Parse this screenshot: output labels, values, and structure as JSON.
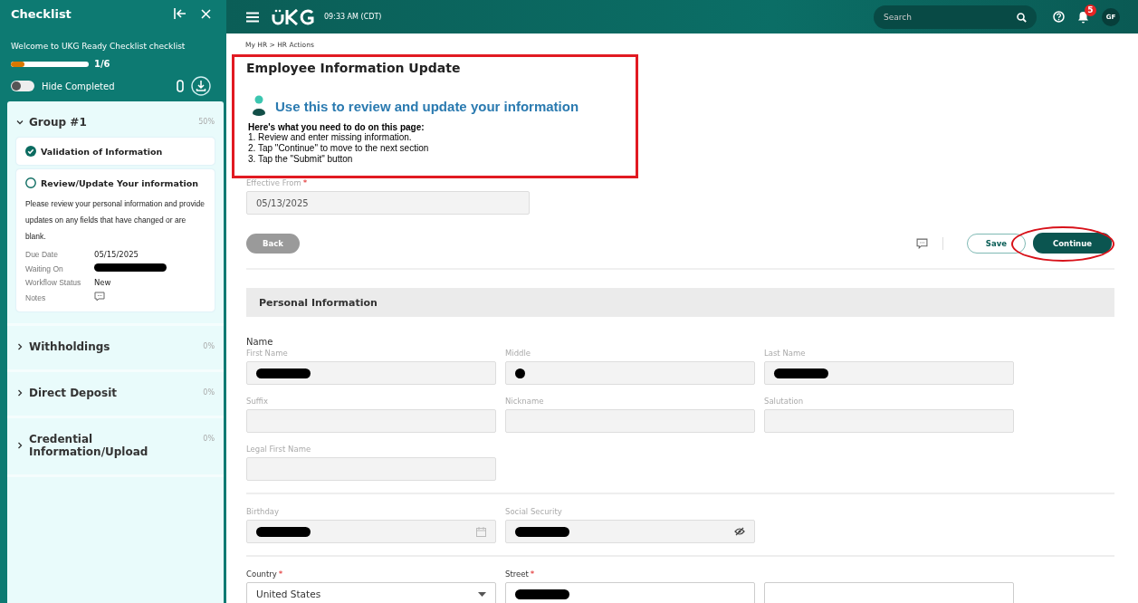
{
  "sidebar": {
    "title": "Checklist",
    "welcome": "Welcome to UKG Ready Checklist checklist",
    "progress": {
      "level": 0.17,
      "reading": "1/6"
    },
    "hide_completed": {
      "label": "Hide Completed",
      "on": false
    },
    "groups": [
      {
        "title": "Group #1",
        "percent": "50%",
        "expanded": true,
        "tasks": [
          {
            "title": "Validation of Information",
            "done": true
          },
          {
            "title": "Review/Update Your information",
            "done": false,
            "description": "Please review your personal information and provide updates on any fields that have changed or are blank.",
            "details": [
              {
                "label": "Due Date",
                "kind": "text",
                "value": "05/15/2025"
              },
              {
                "label": "Waiting On",
                "kind": "redacted"
              },
              {
                "label": "Workflow Status",
                "kind": "text",
                "value": "New"
              },
              {
                "label": "Notes",
                "kind": "notes"
              }
            ]
          }
        ]
      },
      {
        "title": "Withholdings",
        "percent": "0%",
        "expanded": false
      },
      {
        "title": "Direct Deposit",
        "percent": "0%",
        "expanded": false
      },
      {
        "title": "Credential Information/Upload",
        "percent": "0%",
        "expanded": false
      }
    ]
  },
  "topbar": {
    "time": "09:33 AM (CDT)",
    "search": {
      "placeholder": "Search"
    },
    "notifications": "5",
    "avatar": "GF"
  },
  "breadcrumb": "My HR > HR Actions",
  "page_title": "Employee Information Update",
  "banner": {
    "heading": "Use this to review and update your information",
    "instructions_title": "Here's what you need to do on this page:",
    "steps": [
      "1. Review and enter missing information.",
      "2. Tap \"Continue\" to move to the next section",
      "3. Tap the \"Submit\" button"
    ]
  },
  "effective_from": {
    "label": "Effective From",
    "required_mark": "*",
    "value": "05/13/2025"
  },
  "actions": [
    {
      "label": "Back",
      "kind": "back",
      "disabled": true
    },
    {
      "label": "Save",
      "kind": "save",
      "disabled": false
    },
    {
      "label": "Continue",
      "kind": "continue",
      "disabled": false
    }
  ],
  "section": "Personal Information",
  "name_label": "Name",
  "field_blocks": [
    {
      "rows": [
        [
          {
            "label": "First Name",
            "kind": "text",
            "redacted": true,
            "editable": false
          },
          {
            "label": "Middle",
            "kind": "initial",
            "redacted": true,
            "editable": false
          },
          {
            "label": "Last Name",
            "kind": "text",
            "redacted": true,
            "editable": false
          }
        ],
        [
          {
            "label": "Suffix",
            "kind": "text",
            "redacted": false,
            "editable": false
          },
          {
            "label": "Nickname",
            "kind": "text",
            "redacted": false,
            "editable": false
          },
          {
            "label": "Salutation",
            "kind": "text",
            "redacted": false,
            "editable": false
          }
        ],
        [
          {
            "label": "Legal First Name",
            "kind": "text",
            "redacted": false,
            "editable": false
          }
        ]
      ]
    },
    {
      "rows": [
        [
          {
            "label": "Birthday",
            "kind": "date",
            "redacted": true,
            "editable": false
          },
          {
            "label": "Social Security",
            "kind": "secret",
            "redacted": true,
            "editable": false
          }
        ]
      ]
    },
    {
      "rows": [
        [
          {
            "label": "Country",
            "required_mark": "*",
            "kind": "dropdown",
            "value": "United States",
            "redacted": false,
            "editable": true
          },
          {
            "label": "Street",
            "required_mark": "*",
            "kind": "text",
            "redacted": true,
            "editable": true
          },
          {
            "kind": "text",
            "redacted": false,
            "editable": true
          }
        ]
      ]
    }
  ]
}
